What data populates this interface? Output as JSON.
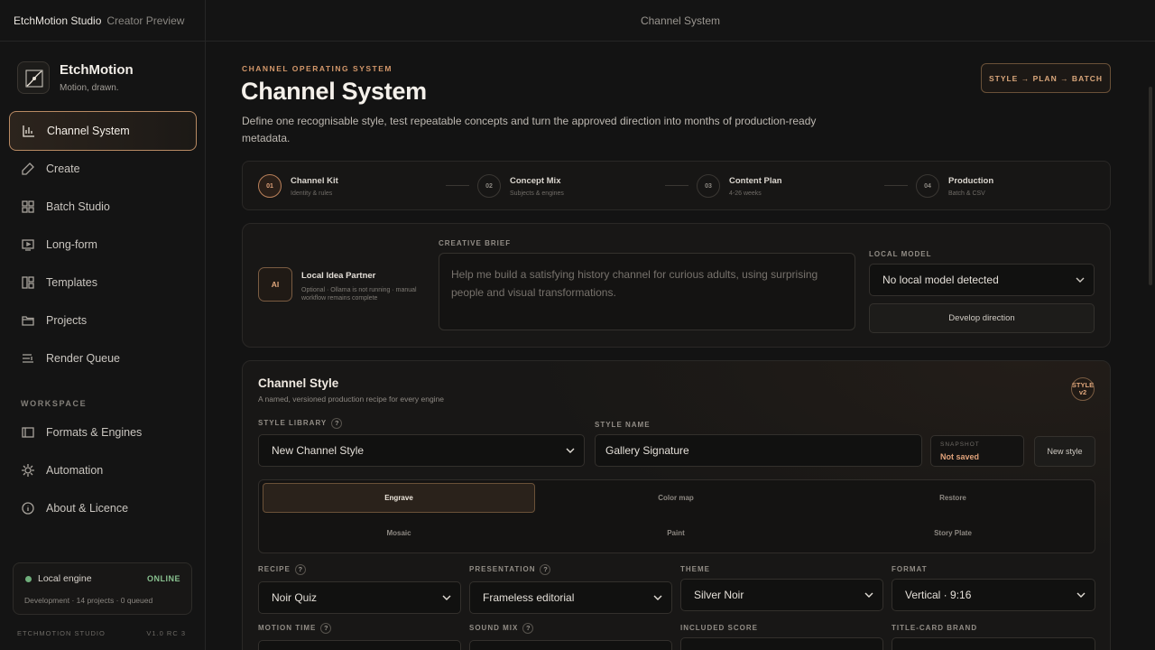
{
  "topbar": {
    "brand": "EtchMotion Studio",
    "brand_sub": "Creator Preview",
    "title": "Channel System"
  },
  "sidebar": {
    "logo_title": "EtchMotion",
    "logo_sub": "Motion, drawn.",
    "items": [
      {
        "label": "Channel System",
        "icon": "bar-chart-icon",
        "active": true
      },
      {
        "label": "Create",
        "icon": "edit-icon"
      },
      {
        "label": "Batch Studio",
        "icon": "grid-icon"
      },
      {
        "label": "Long-form",
        "icon": "video-icon"
      },
      {
        "label": "Templates",
        "icon": "template-icon"
      },
      {
        "label": "Projects",
        "icon": "folder-icon"
      },
      {
        "label": "Render Queue",
        "icon": "queue-icon"
      }
    ],
    "workspace_label": "WORKSPACE",
    "workspace_items": [
      {
        "label": "Formats & Engines",
        "icon": "sidebar-panel-icon"
      },
      {
        "label": "Automation",
        "icon": "cog-icon"
      },
      {
        "label": "About & Licence",
        "icon": "info-icon"
      }
    ],
    "engine": {
      "label": "Local engine",
      "status": "ONLINE",
      "meta": "Development · 14 projects · 0 queued"
    },
    "footer_left": "ETCHMOTION STUDIO",
    "footer_right": "V1.0 RC 3"
  },
  "header": {
    "eyebrow": "CHANNEL OPERATING SYSTEM",
    "title": "Channel System",
    "lead": "Define one recognisable style, test repeatable concepts and turn the approved direction into months of production-ready metadata.",
    "pill": "STYLE → PLAN → BATCH"
  },
  "steps": [
    {
      "num": "01",
      "title": "Channel Kit",
      "sub": "Identity & rules",
      "active": true
    },
    {
      "num": "02",
      "title": "Concept Mix",
      "sub": "Subjects & engines"
    },
    {
      "num": "03",
      "title": "Content Plan",
      "sub": "4-26 weeks"
    },
    {
      "num": "04",
      "title": "Production",
      "sub": "Batch & CSV"
    }
  ],
  "partner": {
    "badge": "AI",
    "title": "Local Idea Partner",
    "sub": "Optional · Ollama is not running · manual workflow remains complete",
    "brief_label": "CREATIVE BRIEF",
    "brief_placeholder": "Help me build a satisfying history channel for curious adults, using surprising people and visual transformations.",
    "model_label": "LOCAL MODEL",
    "model_value": "No local model detected",
    "develop_button": "Develop direction"
  },
  "style": {
    "title": "Channel Style",
    "sub": "A named, versioned production recipe for every engine",
    "badge_line1": "STYLE",
    "badge_line2": "v2",
    "library_label": "STYLE LIBRARY",
    "library_value": "New Channel Style",
    "name_label": "STYLE NAME",
    "name_value": "Gallery Signature",
    "snapshot_label": "SNAPSHOT",
    "snapshot_value": "Not saved",
    "new_style_button": "New style",
    "engines": [
      "Engrave",
      "Color map",
      "Restore",
      "Mosaic",
      "Paint",
      "Story Plate"
    ],
    "recipe_label": "RECIPE",
    "recipe_value": "Noir Quiz",
    "presentation_label": "PRESENTATION",
    "presentation_value": "Frameless editorial",
    "theme_label": "THEME",
    "theme_value": "Silver Noir",
    "format_label": "FORMAT",
    "format_value": "Vertical · 9:16",
    "motion_label": "MOTION TIME",
    "sound_label": "SOUND MIX",
    "score_label": "INCLUDED SCORE",
    "titlecard_label": "TITLE-CARD BRAND"
  }
}
